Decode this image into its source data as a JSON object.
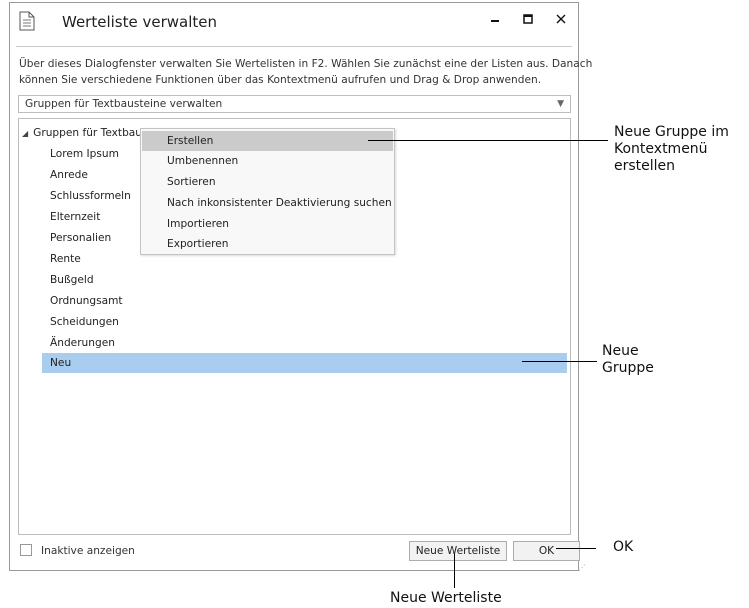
{
  "window": {
    "title": "Werteliste verwalten",
    "controls": {
      "minimize": "‒",
      "maximize": "☐",
      "close": "✕"
    }
  },
  "description": {
    "line1": "Über dieses Dialogfenster verwalten Sie Wertelisten in F2. Wählen Sie zunächst eine der Listen aus. Danach",
    "line2": "können Sie verschiedene Funktionen über das Kontextmenü aufrufen und Drag & Drop anwenden."
  },
  "list_select": {
    "selected": "Gruppen für Textbausteine verwalten"
  },
  "tree": {
    "root_label": "Gruppen für Textbausteine verwalten (lokal) - Administrator Gruppe",
    "items": [
      {
        "label": "Lorem Ipsum"
      },
      {
        "label": "Anrede"
      },
      {
        "label": "Schlussformeln"
      },
      {
        "label": "Elternzeit"
      },
      {
        "label": "Personalien"
      },
      {
        "label": "Rente"
      },
      {
        "label": "Bußgeld"
      },
      {
        "label": "Ordnungsamt"
      },
      {
        "label": "Scheidungen"
      },
      {
        "label": "Änderungen"
      }
    ],
    "selected_item": {
      "label": "Neu"
    }
  },
  "context_menu": {
    "items": [
      {
        "label": "Erstellen"
      },
      {
        "label": "Umbenennen"
      },
      {
        "label": "Sortieren"
      },
      {
        "label": "Nach inkonsistenter Deaktivierung suchen"
      },
      {
        "label": "Importieren"
      },
      {
        "label": "Exportieren"
      }
    ]
  },
  "footer": {
    "checkbox_label": "Inaktive anzeigen",
    "new_list_button": "Neue Werteliste",
    "ok_button": "OK"
  },
  "annotations": {
    "context_menu_note": {
      "line1": "Neue Gruppe im",
      "line2": "Kontextmenü",
      "line3": "erstellen"
    },
    "new_group_note": {
      "line1": "Neue",
      "line2": "Gruppe"
    },
    "ok_note": "OK",
    "new_list_note": "Neue Werteliste"
  },
  "colors": {
    "selection": "#a8cdee",
    "menu_highlight": "#cbcbcb"
  }
}
